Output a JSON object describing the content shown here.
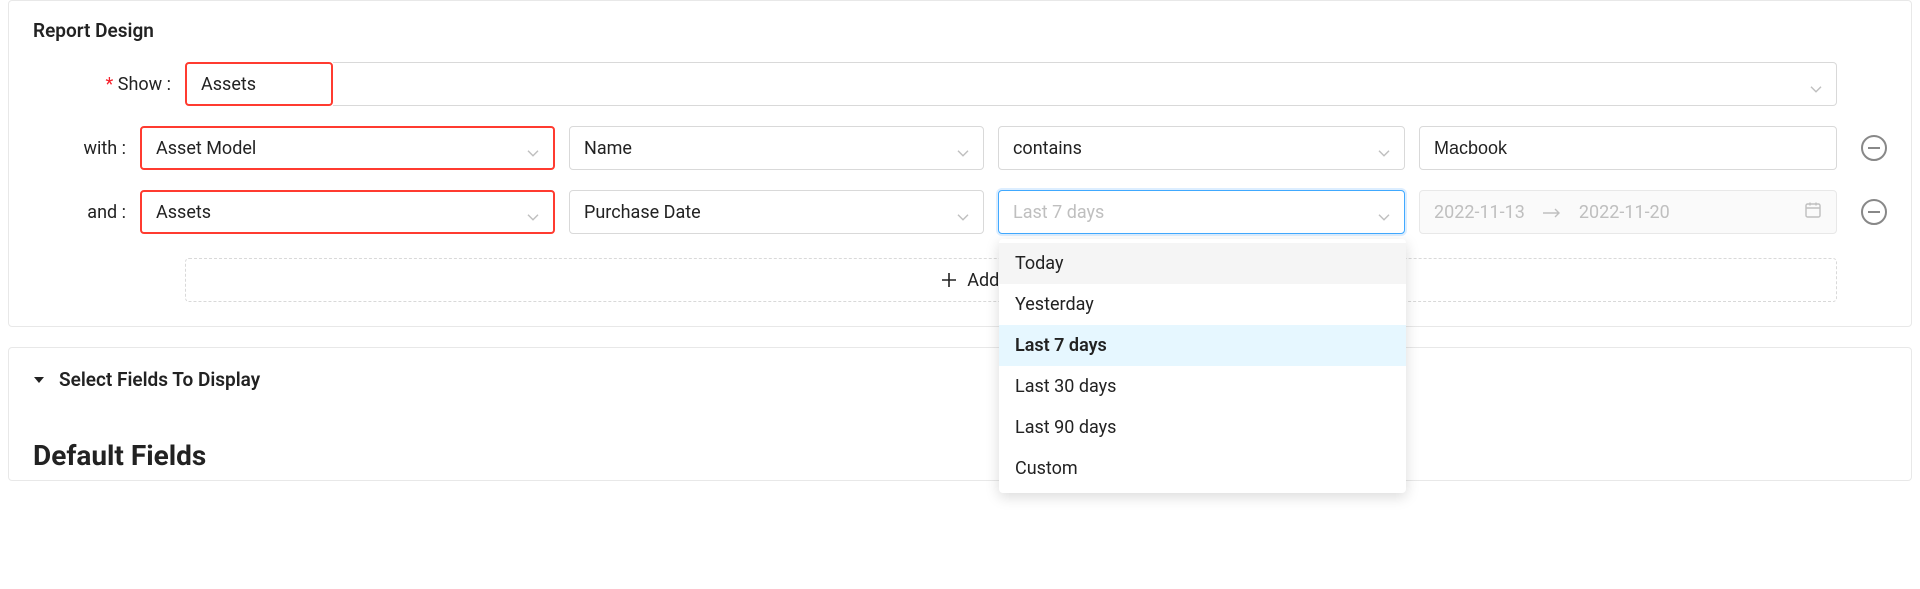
{
  "header": {
    "title": "Report Design"
  },
  "labels": {
    "show": "Show",
    "with": "with",
    "and": "and",
    "add_condition": "Add Condition",
    "select_fields": "Select Fields To Display",
    "default_fields": "Default Fields"
  },
  "show_row": {
    "value": "Assets",
    "highlighted": true
  },
  "conditions": [
    {
      "source": "Asset Model",
      "field": "Name",
      "operator": "contains",
      "value": "Macbook",
      "source_highlighted": true
    },
    {
      "source": "Assets",
      "field": "Purchase Date",
      "operator_placeholder": "Last 7 days",
      "operator_focused": true,
      "date_start": "2022-11-13",
      "date_end": "2022-11-20",
      "source_highlighted": true
    }
  ],
  "dropdown": {
    "options": [
      {
        "label": "Today",
        "hover": true
      },
      {
        "label": "Yesterday"
      },
      {
        "label": "Last 7 days",
        "selected": true
      },
      {
        "label": "Last 30 days"
      },
      {
        "label": "Last 90 days"
      },
      {
        "label": "Custom"
      }
    ]
  }
}
